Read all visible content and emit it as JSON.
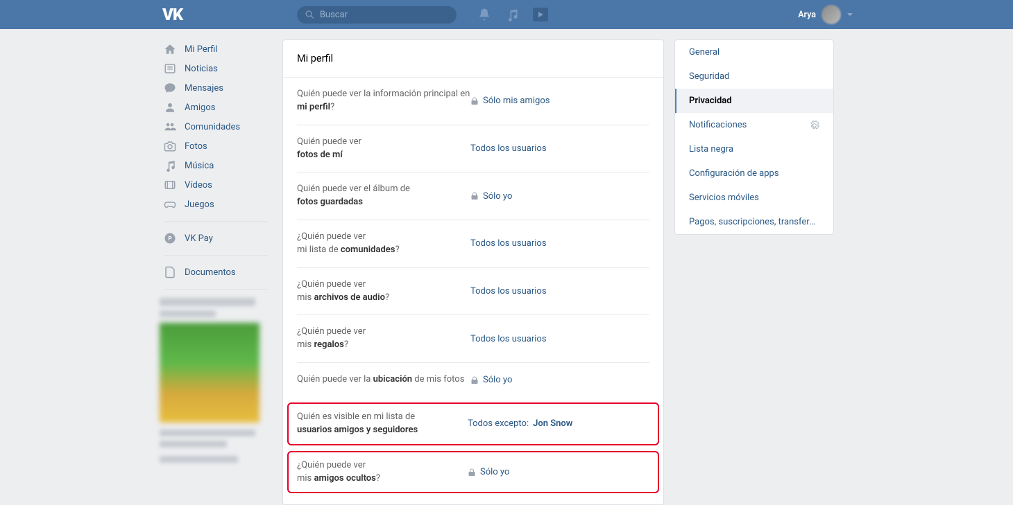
{
  "header": {
    "search_placeholder": "Buscar",
    "user_name": "Arya"
  },
  "sidebar": {
    "items": [
      {
        "label": "Mi Perfil"
      },
      {
        "label": "Noticias"
      },
      {
        "label": "Mensajes"
      },
      {
        "label": "Amigos"
      },
      {
        "label": "Comunidades"
      },
      {
        "label": "Fotos"
      },
      {
        "label": "Música"
      },
      {
        "label": "Vídeos"
      },
      {
        "label": "Juegos"
      }
    ],
    "pay": "VK Pay",
    "docs": "Documentos"
  },
  "main": {
    "title": "Mi perfil",
    "rows": [
      {
        "q_pre": "Quién puede ver la información principal en ",
        "q_b": "mi perfil",
        "q_post": "?",
        "locked": true,
        "value": "Sólo mis amigos"
      },
      {
        "q_pre": "Quién puede ver",
        "q_b": "fotos de mí",
        "q_post": "",
        "locked": false,
        "value": "Todos los usuarios",
        "break": true
      },
      {
        "q_pre": "Quién puede ver el álbum de",
        "q_b": "fotos guardadas",
        "q_post": "",
        "locked": true,
        "value": "Sólo yo",
        "break": true
      },
      {
        "q_pre": "¿Quién puede ver",
        "q_mid": "mi lista de ",
        "q_b": "comunidades",
        "q_post": "?",
        "locked": false,
        "value": "Todos los usuarios",
        "break": true
      },
      {
        "q_pre": "¿Quién puede ver",
        "q_mid": "mis ",
        "q_b": "archivos de audio",
        "q_post": "?",
        "locked": false,
        "value": "Todos los usuarios",
        "break": true
      },
      {
        "q_pre": "¿Quién puede ver",
        "q_mid": "mis ",
        "q_b": "regalos",
        "q_post": "?",
        "locked": false,
        "value": "Todos los usuarios",
        "break": true
      },
      {
        "q_pre": "Quién puede ver la ",
        "q_b": "ubicación",
        "q_post": " de mis fotos",
        "locked": true,
        "value": "Sólo yo"
      }
    ],
    "hi1": {
      "q_pre": "Quién es visible en mi lista de",
      "q_b": "usuarios amigos y seguidores",
      "value_pre": "Todos excepto: ",
      "value_b": "Jon Snow"
    },
    "hi2": {
      "q_pre": "¿Quién puede ver",
      "q_mid": "mis ",
      "q_b": "amigos ocultos",
      "q_post": "?",
      "locked": true,
      "value": "Sólo yo"
    }
  },
  "right": {
    "items": [
      {
        "label": "General"
      },
      {
        "label": "Seguridad"
      },
      {
        "label": "Privacidad",
        "active": true
      },
      {
        "label": "Notificaciones",
        "gear": true
      },
      {
        "label": "Lista negra"
      },
      {
        "label": "Configuración de apps"
      },
      {
        "label": "Servicios móviles"
      },
      {
        "label": "Pagos, suscripciones, transferencias"
      }
    ]
  }
}
